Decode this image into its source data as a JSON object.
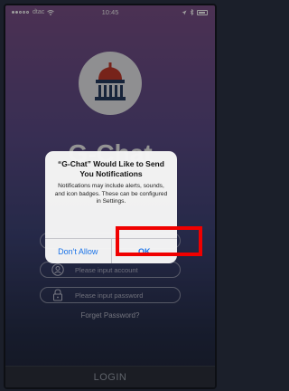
{
  "status_bar": {
    "carrier": "dtac",
    "time": "10:45"
  },
  "app": {
    "brand_text": "G-Chat"
  },
  "login_form": {
    "account_placeholder": "Please input account",
    "password_placeholder": "Please input password",
    "forgot_password": "Forget Password?",
    "login_label": "LOGIN"
  },
  "alert": {
    "title": "“G-Chat” Would Like to Send You Notifications",
    "message": "Notifications may include alerts, sounds, and icon badges. These can be configured in Settings.",
    "dont_allow_label": "Don't Allow",
    "ok_label": "OK"
  },
  "colors": {
    "highlight": "#f00000",
    "ios_blue": "#1a73e8",
    "logo_red": "#c0392b",
    "logo_navy": "#263a5e"
  },
  "icons": [
    "wifi-icon",
    "location-icon",
    "bluetooth-icon",
    "battery-icon",
    "government-building-icon",
    "user-icon",
    "lock-icon"
  ]
}
